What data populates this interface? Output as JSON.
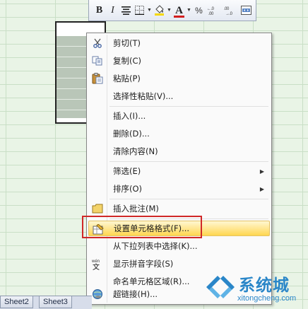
{
  "sheet_tabs": [
    {
      "label": "Sheet2"
    },
    {
      "label": "Sheet3"
    }
  ],
  "mini_toolbar": {
    "buttons": [
      "bold-icon",
      "italic-icon",
      "center-align-icon",
      "borders-icon",
      "fill-color-icon",
      "font-color-icon",
      "percent-icon",
      "increase-decimal-icon",
      "decrease-decimal-icon",
      "merge-center-icon"
    ],
    "bold_label": "B",
    "italic_label": "I",
    "increase_decimal_label": "+.0 .00",
    "decrease_decimal_label": ".00 →.0",
    "accent_font_color": "#d21e1e",
    "fill_color": "#f5d800"
  },
  "context_menu": {
    "items": [
      {
        "label": "剪切(T)",
        "icon": "scissors-icon"
      },
      {
        "label": "复制(C)",
        "icon": "copy-icon"
      },
      {
        "label": "粘贴(P)",
        "icon": "paste-icon"
      },
      {
        "label": "选择性粘贴(V)...",
        "icon": ""
      },
      {
        "label": "插入(I)...",
        "icon": ""
      },
      {
        "label": "删除(D)...",
        "icon": ""
      },
      {
        "label": "清除内容(N)",
        "icon": ""
      },
      {
        "label": "筛选(E)",
        "icon": "",
        "submenu": "▶"
      },
      {
        "label": "排序(O)",
        "icon": "",
        "submenu": "▶"
      },
      {
        "label": "插入批注(M)",
        "icon": "comment-icon"
      },
      {
        "label": "设置单元格格式(F)...",
        "icon": "format-cells-icon",
        "highlighted": true
      },
      {
        "label": "从下拉列表中选择(K)...",
        "icon": ""
      },
      {
        "label": "显示拼音字段(S)",
        "icon": "phonetic-icon"
      },
      {
        "label": "命名单元格区域(R)...",
        "icon": ""
      },
      {
        "label": "超链接(H)...",
        "icon": "hyperlink-icon"
      }
    ],
    "highlight_color": "#ffe58c",
    "annotation_box_color": "#d02828"
  },
  "watermark": {
    "text": "系统城",
    "subtext": "xitongcheng.com",
    "color": "#2a86c8"
  }
}
